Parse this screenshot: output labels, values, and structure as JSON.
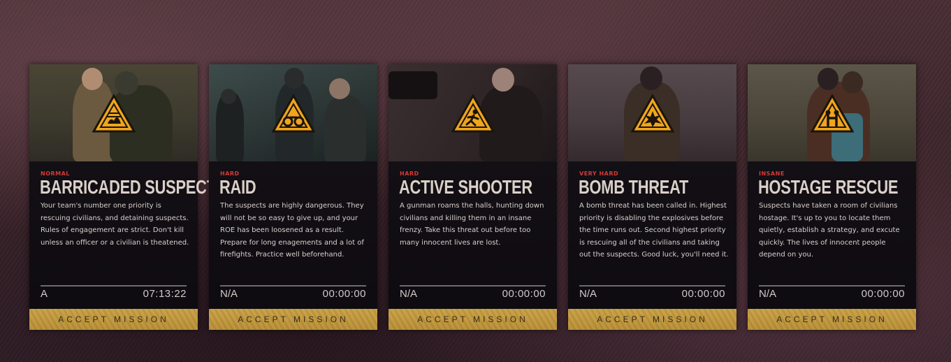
{
  "accent_gold": "#c9a043",
  "difficulty_color": "#d43a36",
  "cards": [
    {
      "difficulty": "NORMAL",
      "title": "BARRICADED SUSPECTS",
      "description": "Your team's number one priority is rescuing civilians, and detaining suspects. Rules of engagement are strict. Don't kill unless an officer or a civilian is theatened.",
      "grade": "A",
      "time": "07:13:22",
      "button": "ACCEPT MISSION",
      "icon": "barricade-hazard-icon"
    },
    {
      "difficulty": "HARD",
      "title": "RAID",
      "description": "The suspects are highly dangerous. They will not be so easy to give up, and your ROE has been loosened as a result. Prepare for long enagements and a lot of firefights. Practice well beforehand.",
      "grade": "N/A",
      "time": "00:00:00",
      "button": "ACCEPT MISSION",
      "icon": "binoculars-hazard-icon"
    },
    {
      "difficulty": "HARD",
      "title": "ACTIVE SHOOTER",
      "description": "A gunman roams the halls, hunting down civilians and killing them in an insane frenzy. Take this threat out before too many innocent lives are lost.",
      "grade": "N/A",
      "time": "00:00:00",
      "button": "ACCEPT MISSION",
      "icon": "running-person-hazard-icon"
    },
    {
      "difficulty": "VERY HARD",
      "title": "BOMB THREAT",
      "description": "A bomb threat has been called in. Highest priority is disabling the explosives before the time runs out. Second highest priority is rescuing all of the civilians and taking out the suspects. Good luck, you'll need it.",
      "grade": "N/A",
      "time": "00:00:00",
      "button": "ACCEPT MISSION",
      "icon": "explosion-hazard-icon"
    },
    {
      "difficulty": "INSANE",
      "title": "HOSTAGE RESCUE",
      "description": "Suspects have taken a room of civilians hostage. It's up to you to locate them quietly, establish a strategy, and excute quickly. The lives of innocent people depend on you.",
      "grade": "N/A",
      "time": "00:00:00",
      "button": "ACCEPT MISSION",
      "icon": "hostage-hazard-icon"
    }
  ]
}
